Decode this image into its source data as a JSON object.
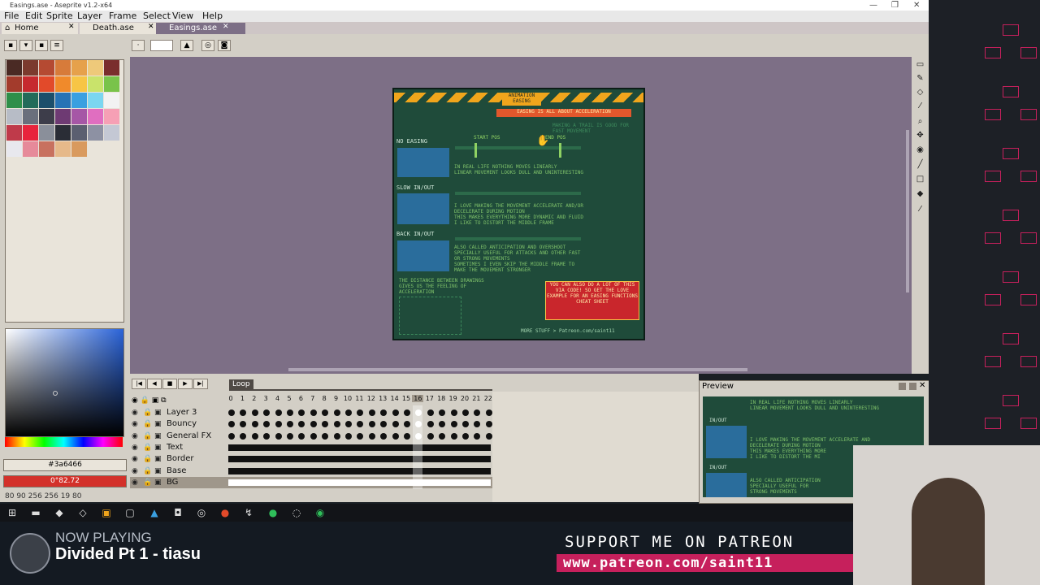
{
  "window": {
    "title": "Easings.ase - Aseprite v1.2-x64",
    "controls": [
      "—",
      "❐",
      "✕"
    ]
  },
  "menu": [
    "File",
    "Edit",
    "Sprite",
    "Layer",
    "Frame",
    "Select",
    "View",
    "Help"
  ],
  "tabs": [
    {
      "label": "Home",
      "close": "✕"
    },
    {
      "label": "Death.ase",
      "close": "✕"
    },
    {
      "label": "Easings.ase",
      "close": "✕"
    }
  ],
  "colors": {
    "fg_hex": "#3a6466",
    "bg_label": "0°82.72",
    "palette": [
      "#4a2a24",
      "#7b3a2e",
      "#b54a32",
      "#d77b3a",
      "#e6a14b",
      "#eec97a",
      "#7a2d2d",
      "#a33b2c",
      "#c6292f",
      "#e24a2a",
      "#f08a2b",
      "#f7c545",
      "#c9e36b",
      "#79c34a",
      "#2e8f4a",
      "#236b5a",
      "#1c4f6b",
      "#2773b5",
      "#3aa0e0",
      "#7bd6f0",
      "#f2f2f2",
      "#b7bcc6",
      "#6a6f7c",
      "#3d3d4a",
      "#6e3a73",
      "#a657a6",
      "#e06ec0",
      "#f6a0b5",
      "#bf3a4a",
      "#e8243c",
      "#8a8f9a",
      "#2a2d36",
      "#5b5f70",
      "#8d91a3",
      "#c4c8d4",
      "#e8e8ee",
      "#e68a9a",
      "#c8715f",
      "#e6b98a",
      "#d99a5e"
    ]
  },
  "status": {
    "text": "80 90   256 256   19   80"
  },
  "artwork": {
    "title": "ANIMATION EASING",
    "subtitle": "EASING IS ALL ABOUT ACCELERATION",
    "trail_note": "MAKING A TRAIL IS GOOD FOR FAST MOVEMENT",
    "start_pos": "START POS",
    "end_pos": "END POS",
    "sections": [
      {
        "label": "NO EASING",
        "text": "IN REAL LIFE NOTHING MOVES LINEARLY\nLINEAR MOVEMENT LOOKS DULL AND UNINTERESTING"
      },
      {
        "label": "SLOW IN/OUT",
        "text": "I LOVE MAKING THE MOVEMENT ACCELERATE AND/OR\nDECELERATE DURING MOTION\nTHIS MAKES EVERYTHING MORE DYNAMIC AND FLUID\nI LIKE TO DISTORT THE MIDDLE FRAME"
      },
      {
        "label": "BACK IN/OUT",
        "text": "ALSO CALLED ANTICIPATION AND OVERSHOOT\nSPECIALLY USEFUL FOR ATTACKS AND OTHER FAST\nOR STRONG MOVEMENTS\nSOMETIMES I EVEN SKIP THE MIDDLE FRAME TO\nMAKE THE MOVEMENT STRONGER"
      }
    ],
    "distance_note": "THE DISTANCE BETWEEN DRAWINGS GIVES US THE FEELING OF ACCELERATION",
    "love_box": "YOU CAN ALSO DO A LOT OF THIS VIA CODE! SO GET THE LOVE EXAMPLE FOR AN EASING FUNCTIONS CHEAT SHEET",
    "footer": "MORE STUFF > Patreon.com/saint11"
  },
  "timeline": {
    "loop_label": "Loop",
    "frames": [
      "0",
      "1",
      "2",
      "3",
      "4",
      "5",
      "6",
      "7",
      "8",
      "9",
      "10",
      "11",
      "12",
      "13",
      "14",
      "15",
      "16",
      "17",
      "18",
      "19",
      "20",
      "21",
      "22"
    ],
    "current_frame": 16,
    "layers": [
      "Layer 3",
      "Bouncy",
      "General FX",
      "Text",
      "Border",
      "Base",
      "BG"
    ]
  },
  "preview": {
    "title": "Preview",
    "lines": [
      "IN REAL LIFE NOTHING MOVES LINEARLY",
      "LINEAR MOVEMENT LOOKS DULL AND UNINTERESTING",
      "IN/OUT",
      "I LOVE MAKING THE MOVEMENT ACCELERATE AND",
      "DECELERATE DURING MOTION",
      "THIS MAKES EVERYTHING MORE",
      "I LIKE TO DISTORT THE MI",
      "IN/OUT",
      "ALSO CALLED ANTICIPATION",
      "SPECIALLY USEFUL FOR",
      "STRONG MOVEMENTS"
    ]
  },
  "stream": {
    "now_playing": "NOW PLAYING",
    "track": "Divided Pt 1 - tiasu",
    "support": "SUPPORT ME ON PATREON",
    "url": "www.patreon.com/saint11"
  }
}
